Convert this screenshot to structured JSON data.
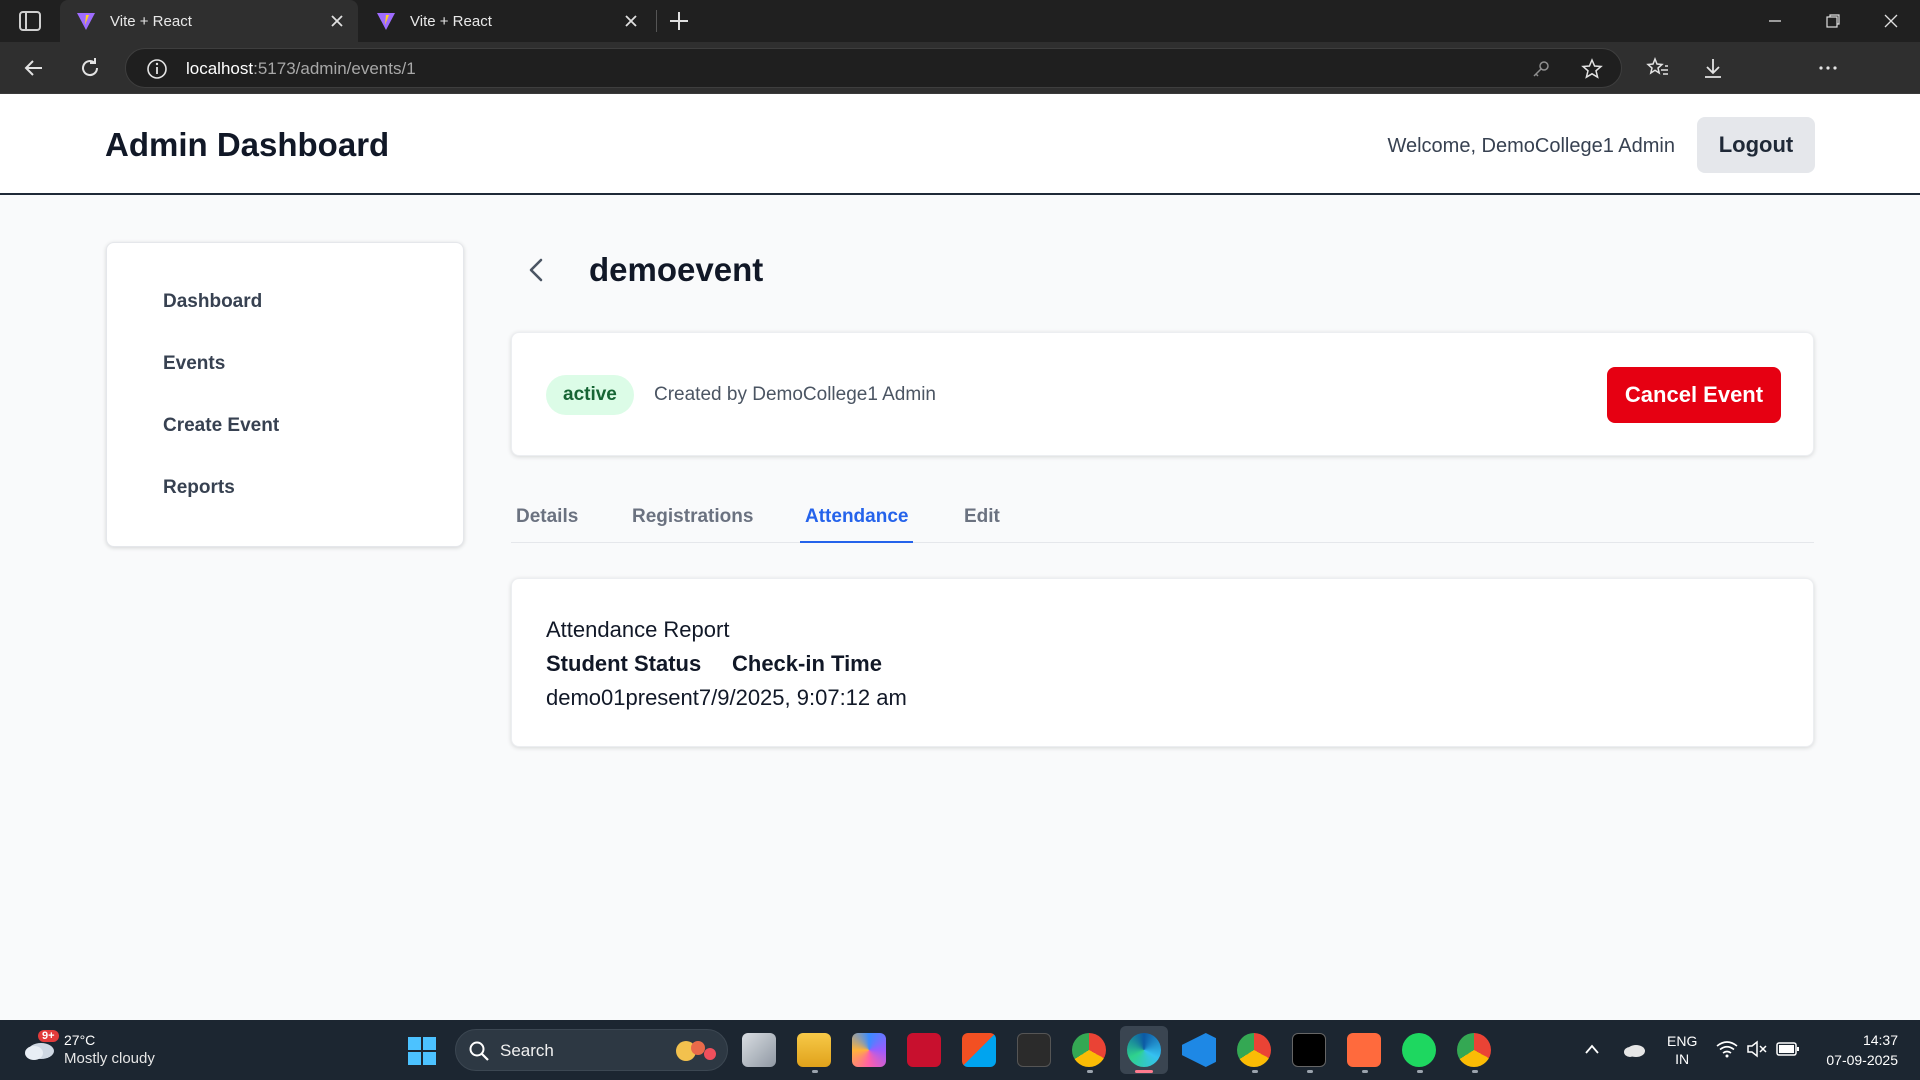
{
  "browser": {
    "tabs": [
      {
        "title": "Vite + React",
        "active": true
      },
      {
        "title": "Vite + React",
        "active": false
      }
    ],
    "url_host": "localhost",
    "url_rest": ":5173/admin/events/1",
    "icons": [
      "sidebar-toggle-icon",
      "vite-logo-icon",
      "close-icon",
      "new-tab-icon",
      "minimize-icon",
      "maximize-icon",
      "window-close-icon",
      "back-arrow-icon",
      "refresh-icon",
      "info-icon",
      "key-icon",
      "star-icon",
      "favorites-icon",
      "download-icon",
      "more-icon",
      "copilot-icon"
    ]
  },
  "header": {
    "title": "Admin Dashboard",
    "welcome": "Welcome, DemoCollege1 Admin",
    "logout_label": "Logout"
  },
  "sidebar": {
    "items": [
      {
        "label": "Dashboard"
      },
      {
        "label": "Events"
      },
      {
        "label": "Create Event"
      },
      {
        "label": "Reports"
      }
    ]
  },
  "event": {
    "title": "demoevent",
    "status": "active",
    "created_by": "Created by DemoCollege1 Admin",
    "cancel_label": "Cancel Event"
  },
  "tabs": [
    {
      "label": "Details",
      "active": false
    },
    {
      "label": "Registrations",
      "active": false
    },
    {
      "label": "Attendance",
      "active": true
    },
    {
      "label": "Edit",
      "active": false
    }
  ],
  "attendance": {
    "title": "Attendance Report",
    "headers": [
      "Student Status",
      "Check-in Time"
    ],
    "row_text": "demo01present7/9/2025, 9:07:12 am"
  },
  "colors": {
    "accent": "#2563eb",
    "danger": "#e60012",
    "badge_bg": "#dcfce7",
    "badge_text": "#166534"
  },
  "taskbar": {
    "weather_temp": "27°C",
    "weather_cond": "Mostly cloudy",
    "weather_badge": "9+",
    "search_label": "Search",
    "lang_top": "ENG",
    "lang_bottom": "IN",
    "time": "14:37",
    "date": "07-09-2025"
  }
}
